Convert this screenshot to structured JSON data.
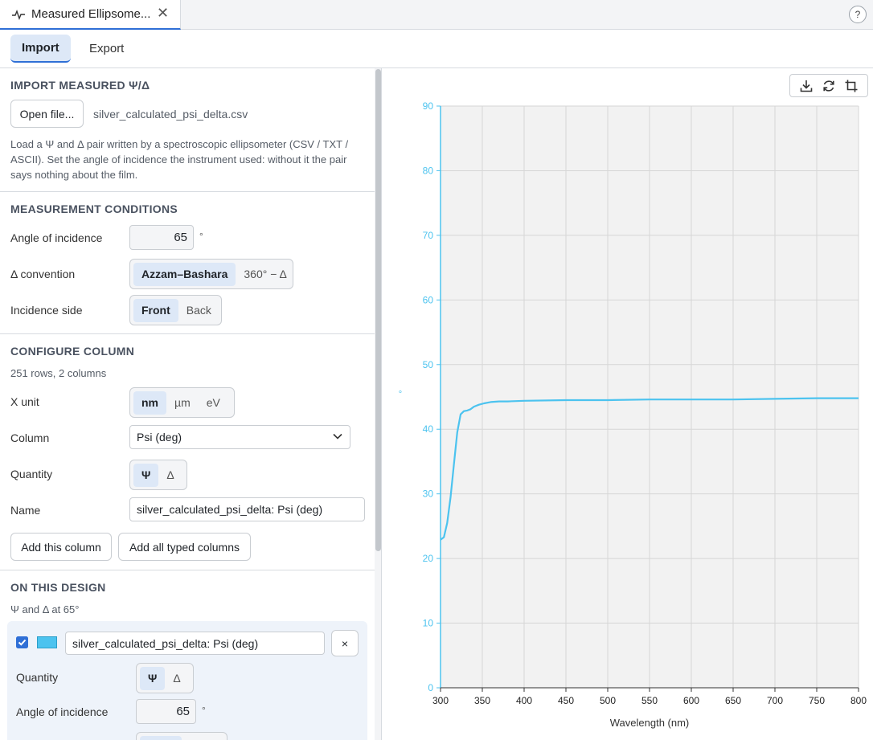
{
  "window": {
    "tab_title": "Measured Ellipsome...",
    "help": "?"
  },
  "subtabs": [
    "Import",
    "Export"
  ],
  "import": {
    "heading": "IMPORT MEASURED Ψ/Δ",
    "open_button": "Open file...",
    "file_name": "silver_calculated_psi_delta.csv",
    "help_text": "Load a Ψ and Δ pair written by a spectroscopic ellipsometer (CSV / TXT / ASCII). Set the angle of incidence the instrument used: without it the pair says nothing about the film."
  },
  "conditions": {
    "heading": "MEASUREMENT CONDITIONS",
    "angle_label": "Angle of incidence",
    "angle_value": "65",
    "angle_unit": "°",
    "delta_label": "Δ convention",
    "delta_options": [
      "Azzam–Bashara",
      "360° − Δ"
    ],
    "delta_selected": "Azzam–Bashara",
    "side_label": "Incidence side",
    "side_options": [
      "Front",
      "Back"
    ],
    "side_selected": "Front"
  },
  "configure": {
    "heading": "CONFIGURE COLUMN",
    "summary": "251 rows, 2 columns",
    "xunit_label": "X unit",
    "xunit_options": [
      "nm",
      "µm",
      "eV"
    ],
    "xunit_selected": "nm",
    "column_label": "Column",
    "column_value": "Psi (deg)",
    "quantity_label": "Quantity",
    "quantity_options": [
      "Ψ",
      "Δ"
    ],
    "quantity_selected": "Ψ",
    "name_label": "Name",
    "name_value": "silver_calculated_psi_delta: Psi (deg)",
    "add_column": "Add this column",
    "add_all": "Add all typed columns"
  },
  "design": {
    "heading": "ON THIS DESIGN",
    "subtitle": "Ψ and Δ at 65°",
    "item": {
      "checked": true,
      "color": "#4cc3ef",
      "name": "silver_calculated_psi_delta: Psi (deg)",
      "remove": "×",
      "quantity_label": "Quantity",
      "quantity_options": [
        "Ψ",
        "Δ"
      ],
      "quantity_selected": "Ψ",
      "angle_label": "Angle of incidence",
      "angle_value": "65",
      "angle_unit": "°"
    }
  },
  "chart_toolbar": [
    "download-icon",
    "reset-icon",
    "crop-icon"
  ],
  "chart_data": {
    "type": "line",
    "xlabel": "Wavelength (nm)",
    "ylabel": "°",
    "xlim": [
      300,
      800
    ],
    "ylim": [
      0,
      90
    ],
    "xticks": [
      300,
      350,
      400,
      450,
      500,
      550,
      600,
      650,
      700,
      750,
      800
    ],
    "yticks": [
      0,
      10,
      20,
      30,
      40,
      50,
      60,
      70,
      80,
      90
    ],
    "grid": true,
    "series": [
      {
        "color": "#4cc3ef",
        "x": [
          300,
          304,
          308,
          312,
          316,
          320,
          324,
          328,
          332,
          336,
          340,
          346,
          352,
          360,
          370,
          380,
          400,
          450,
          500,
          550,
          600,
          650,
          700,
          750,
          800
        ],
        "y": [
          22.9,
          23.3,
          25.5,
          29.5,
          34.5,
          39.5,
          42.3,
          42.8,
          42.9,
          43.1,
          43.5,
          43.8,
          44.0,
          44.2,
          44.3,
          44.3,
          44.4,
          44.5,
          44.5,
          44.6,
          44.6,
          44.6,
          44.7,
          44.8,
          44.8
        ]
      }
    ]
  }
}
